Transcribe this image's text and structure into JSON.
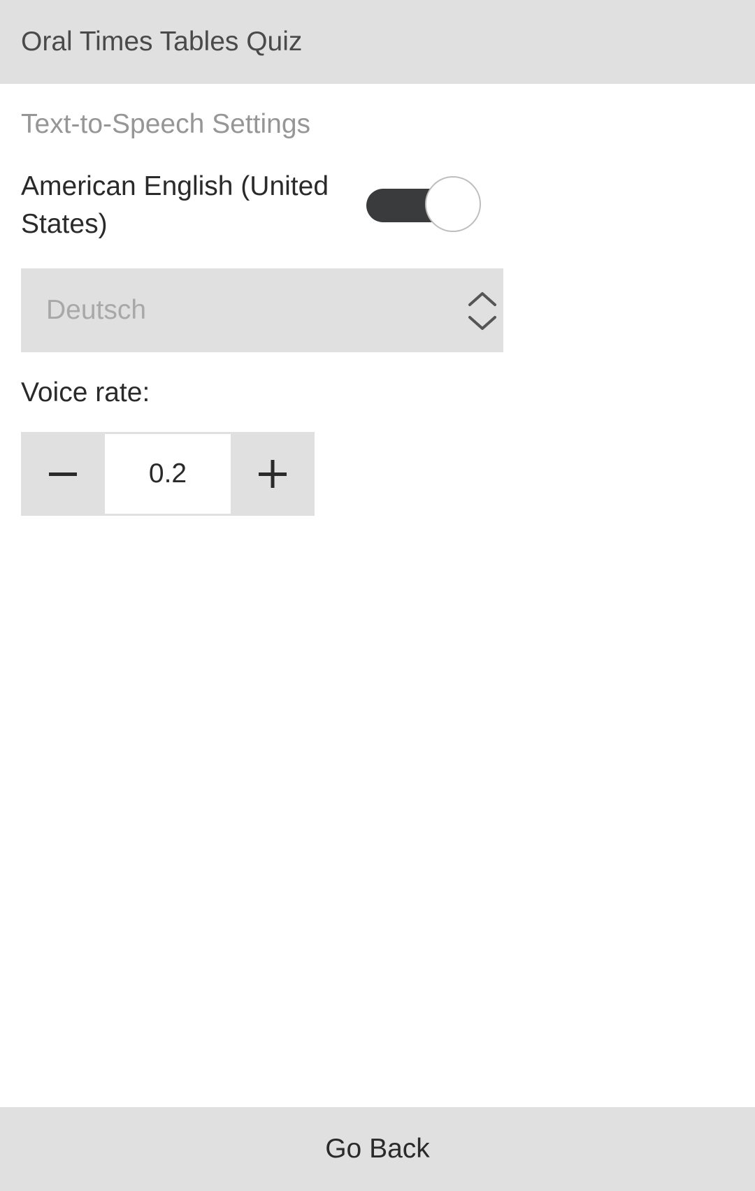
{
  "header": {
    "title": "Oral Times Tables Quiz"
  },
  "tts_settings": {
    "heading": "Text-to-Speech Settings",
    "voice_label": "American English (United States)",
    "voice_toggle_on": true,
    "language_select": {
      "selected": "Deutsch"
    },
    "rate_label": "Voice rate:",
    "rate_value": "0.2"
  },
  "footer": {
    "go_back_label": "Go Back"
  },
  "icons": {
    "minus": "minus-icon",
    "plus": "plus-icon",
    "select_arrows": "chevron-up-down-icon"
  },
  "colors": {
    "header_bg": "#e0e0e0",
    "toggle_track": "#3a3b3d",
    "muted_text": "#969696",
    "body_text": "#2a2a2a"
  }
}
